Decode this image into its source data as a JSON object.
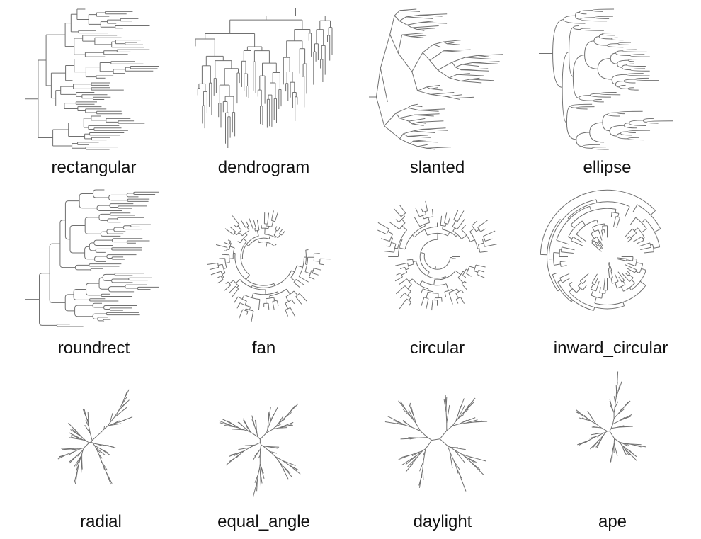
{
  "figure": {
    "layouts": [
      {
        "id": "rectangular",
        "label": "rectangular"
      },
      {
        "id": "dendrogram",
        "label": "dendrogram"
      },
      {
        "id": "slanted",
        "label": "slanted"
      },
      {
        "id": "ellipse",
        "label": "ellipse"
      },
      {
        "id": "roundrect",
        "label": "roundrect"
      },
      {
        "id": "fan",
        "label": "fan"
      },
      {
        "id": "circular",
        "label": "circular"
      },
      {
        "id": "inward_circular",
        "label": "inward_circular"
      },
      {
        "id": "radial",
        "label": "radial"
      },
      {
        "id": "equal_angle",
        "label": "equal_angle"
      },
      {
        "id": "daylight",
        "label": "daylight"
      },
      {
        "id": "ape",
        "label": "ape"
      }
    ]
  },
  "colors": {
    "branch": "#707070",
    "label": "#111111",
    "background": "#ffffff"
  }
}
